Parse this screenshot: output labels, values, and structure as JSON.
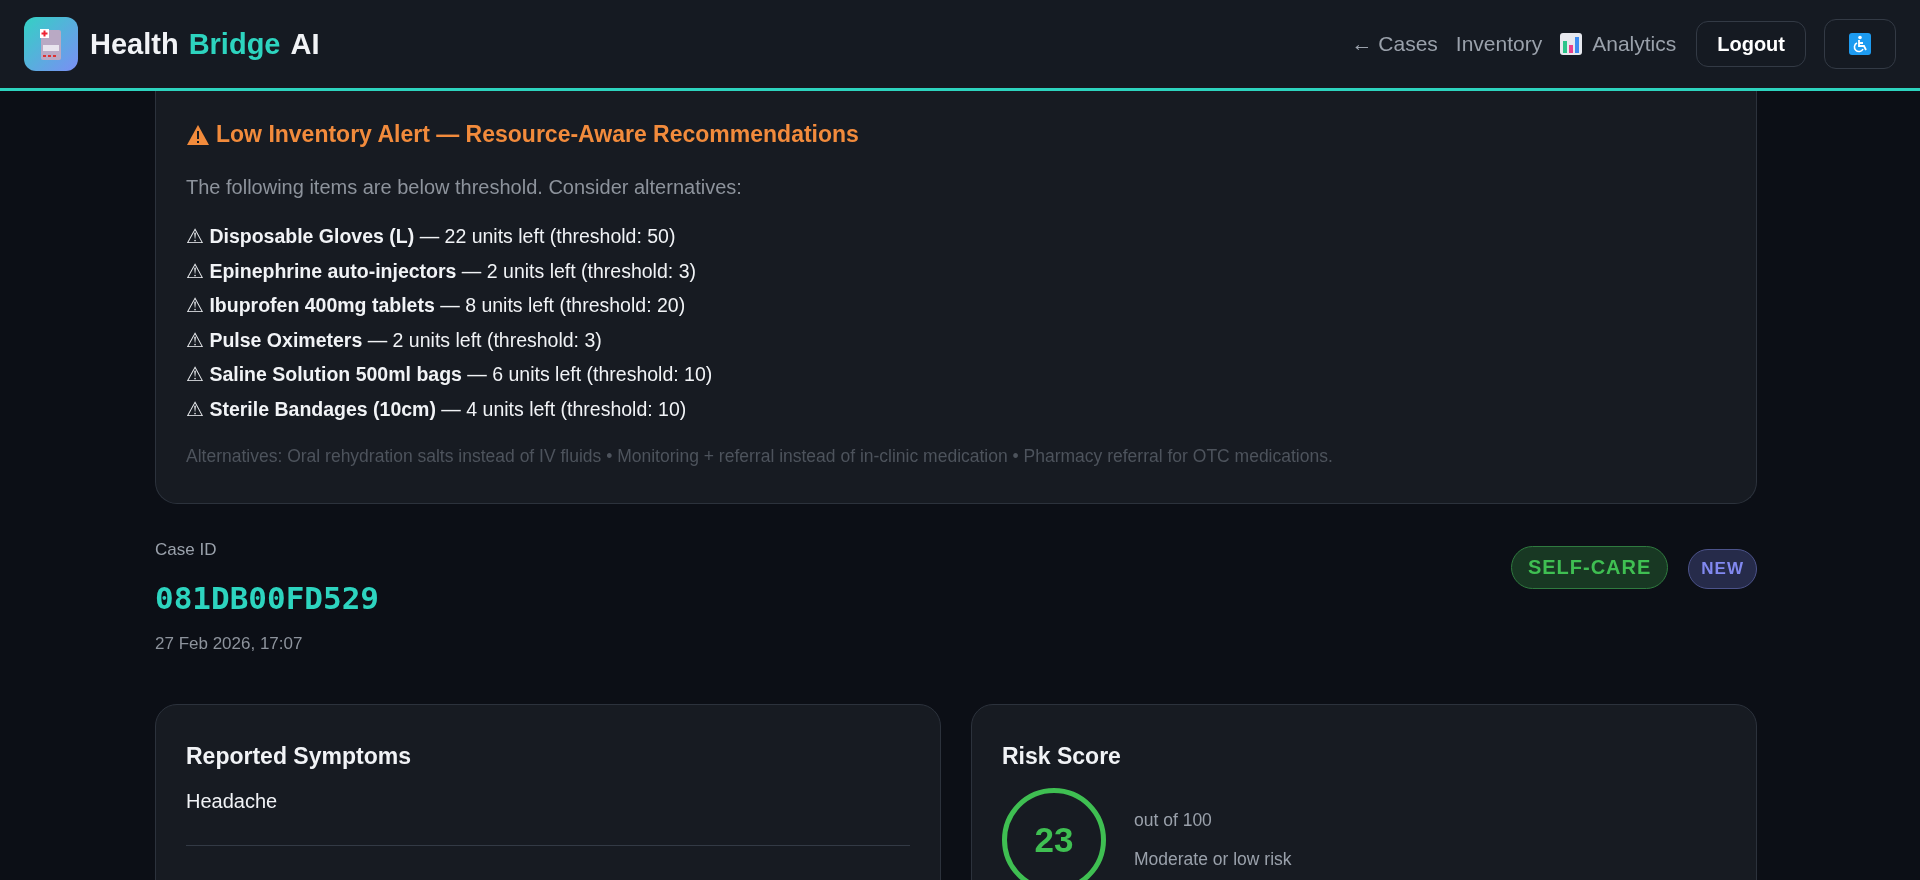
{
  "header": {
    "brand": [
      {
        "text": "Health",
        "accent": false
      },
      {
        "text": "Bridge",
        "accent": true
      },
      {
        "text": "AI",
        "accent": false
      }
    ],
    "nav": [
      {
        "label": "← Cases",
        "kind": "plain"
      },
      {
        "label": "Inventory",
        "kind": "plain"
      },
      {
        "label": "Analytics",
        "kind": "chart"
      }
    ],
    "logout": "Logout"
  },
  "alert": {
    "title": "Low Inventory Alert — Resource-Aware Recommendations",
    "intro": "The following items are below threshold. Consider alternatives:",
    "items": [
      "⚠ **Disposable Gloves (L)** — 22 units left (threshold: 50)",
      "⚠ **Epinephrine auto-injectors** — 2 units left (threshold: 3)",
      "⚠ **Ibuprofen 400mg tablets** — 8 units left (threshold: 20)",
      "⚠ **Pulse Oximeters** — 2 units left (threshold: 3)",
      "⚠ **Saline Solution 500ml bags** — 6 units left (threshold: 10)",
      "⚠ **Sterile Bandages (10cm)** — 4 units left (threshold: 10)"
    ],
    "note": "Alternatives: Oral rehydration salts instead of IV fluids • Monitoring + referral instead of in-clinic medication • Pharmacy referral for OTC medications."
  },
  "case": {
    "label": "Case ID",
    "id": "081DB00FD529",
    "date": "27 Feb 2026, 17:07",
    "badges": [
      {
        "text": "SELF-CARE",
        "kind": "triage"
      },
      {
        "text": "NEW",
        "kind": "status"
      }
    ]
  },
  "symptoms": {
    "title": "Reported Symptoms",
    "text": "Headache"
  },
  "risk": {
    "title": "Risk Score",
    "score": "23",
    "scale": "out of 100",
    "description": "Moderate or low risk"
  }
}
